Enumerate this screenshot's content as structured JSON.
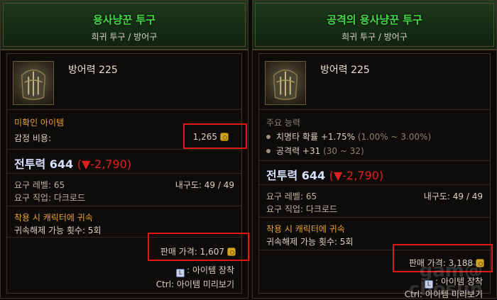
{
  "left": {
    "title": "용사냥꾼 투구",
    "subtitle": "희귀 투구 / 방어구",
    "armor": "방어력 225",
    "unidentified": "미확인 아이템",
    "appraise_label": "감정 비용:",
    "appraise_value": "1,265",
    "cp_label": "전투력 644",
    "cp_delta": "(▼-2,790)",
    "req_level": "요구 레벨: 65",
    "durability": "내구도: 49 / 49",
    "req_class": "요구 직업: 다크로드",
    "bind_text": "착용 시 캐릭터에 귀속",
    "unbind_text": "귀속해제 가능 횟수: 5회",
    "sell_label": "판매 가격: 1,607",
    "equip_hint": ": 아이템 장착",
    "preview_hint": "Ctrl: 아이템 미리보기"
  },
  "right": {
    "title": "공격의 용사냥꾼 투구",
    "subtitle": "희귀 투구 / 방어구",
    "armor": "방어력 225",
    "main_abilities": "주요 능력",
    "stat1_main": "치명타 확률 +1.75%",
    "stat1_range": "(1.00% ~ 3.00%)",
    "stat2_main": "공격력 +31",
    "stat2_range": "(30 ~ 32)",
    "cp_label": "전투력 644",
    "cp_delta": "(▼-2,790)",
    "req_level": "요구 레벨: 65",
    "durability": "내구도: 49 / 49",
    "req_class": "요구 직업: 다크로드",
    "bind_text": "착용 시 캐릭터에 귀속",
    "unbind_text": "귀속해제 가능 횟수: 5회",
    "sell_label": "판매 가격: 3,188",
    "equip_hint": ": 아이템 장착",
    "preview_hint": "Ctrl: 아이템 미리보기"
  },
  "watermark": {
    "line1": "gam@",
    "line2": "chosun"
  },
  "colors": {
    "title_green": "#46d646",
    "orange": "#e8a030",
    "red_box": "#e01818",
    "cp_delta": "#e02020"
  },
  "icons": {
    "item": "helmet-icon",
    "currency": "gold-coin-icon",
    "mouse": "mouse-icon"
  }
}
